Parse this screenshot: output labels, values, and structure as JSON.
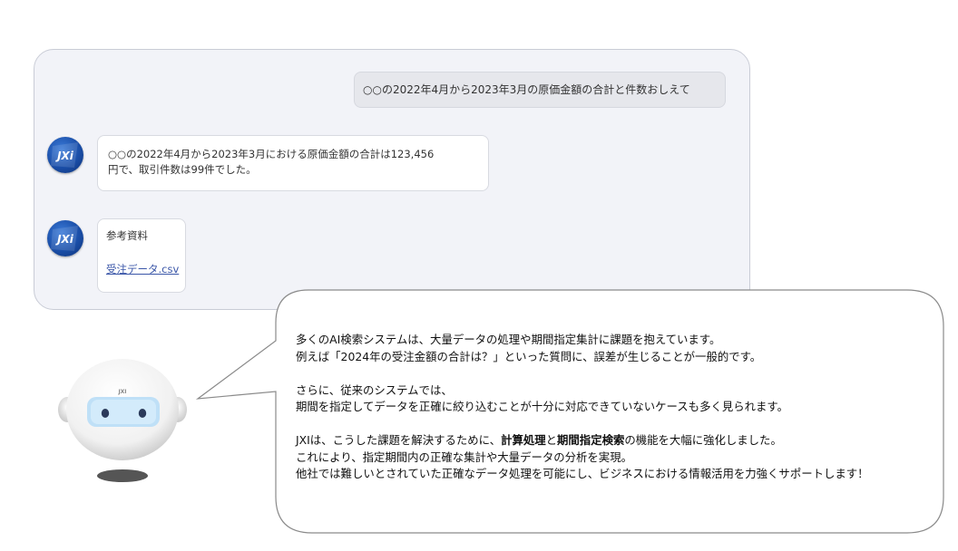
{
  "chat": {
    "user_message": "○○の2022年4月から2023年3月の原価金額の合計と件数おしえて",
    "bot_message_line1": "○○の2022年4月から2023年3月における原価金額の合計は123,456",
    "bot_message_line2": "円で、取引件数は99件でした。",
    "reference_title": "参考資料",
    "reference_link": "受注データ.csv",
    "avatar_logo": "JXi"
  },
  "robot": {
    "badge": "JXI"
  },
  "speech": {
    "p1_line1": "多くのAI検索システムは、大量データの処理や期間指定集計に課題を抱えています。",
    "p1_line2": "例えば「2024年の受注金額の合計は？」といった質問に、誤差が生じることが一般的です。",
    "p2_line1": "さらに、従来のシステムでは、",
    "p2_line2": "期間を指定してデータを正確に絞り込むことが十分に対応できていないケースも多く見られます。",
    "p3_line1_a": "JXIは、こうした課題を解決するために、",
    "p3_line1_b": "計算処理",
    "p3_line1_c": "と",
    "p3_line1_d": "期間指定検索",
    "p3_line1_e": "の機能を大幅に強化しました。",
    "p3_line2": "これにより、指定期間内の正確な集計や大量データの分析を実現。",
    "p3_line3": "他社では難しいとされていた正確なデータ処理を可能にし、ビジネスにおける情報活用を力強くサポートします！"
  },
  "colors": {
    "panel_bg": "#f2f3f8",
    "avatar_blue": "#1a4ea8",
    "link": "#3a56a8",
    "robot_visor": "#bfe0f7"
  }
}
